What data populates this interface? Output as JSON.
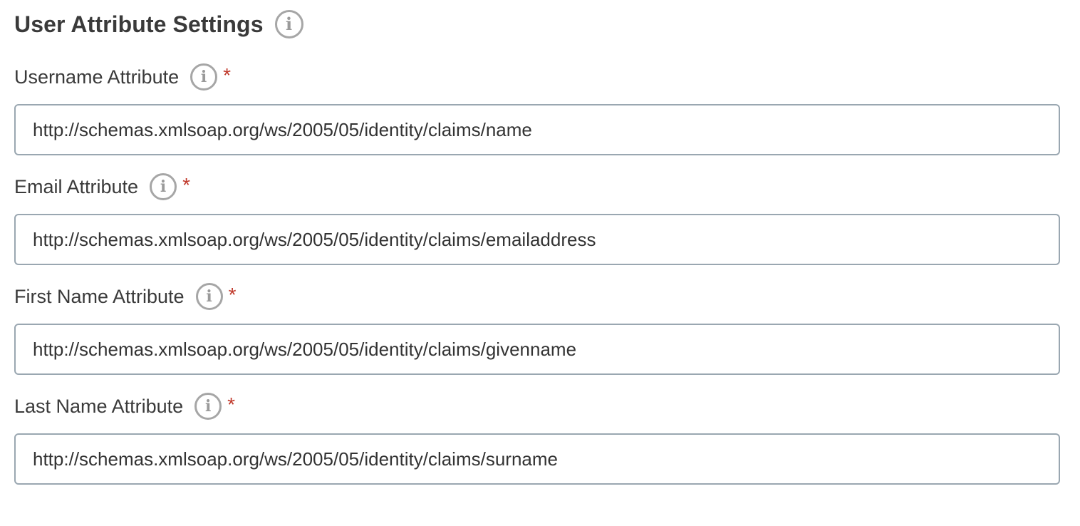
{
  "section": {
    "title": "User Attribute Settings",
    "info_icon": "info-icon"
  },
  "fields": [
    {
      "label": "Username Attribute",
      "required_mark": "*",
      "value": "http://schemas.xmlsoap.org/ws/2005/05/identity/claims/name"
    },
    {
      "label": "Email Attribute",
      "required_mark": "*",
      "value": "http://schemas.xmlsoap.org/ws/2005/05/identity/claims/emailaddress"
    },
    {
      "label": "First Name Attribute",
      "required_mark": "*",
      "value": "http://schemas.xmlsoap.org/ws/2005/05/identity/claims/givenname"
    },
    {
      "label": "Last Name Attribute",
      "required_mark": "*",
      "value": "http://schemas.xmlsoap.org/ws/2005/05/identity/claims/surname"
    }
  ],
  "colors": {
    "required": "#c0392b",
    "input_border": "#9aa7b1",
    "icon_gray": "#a6a6a6"
  }
}
